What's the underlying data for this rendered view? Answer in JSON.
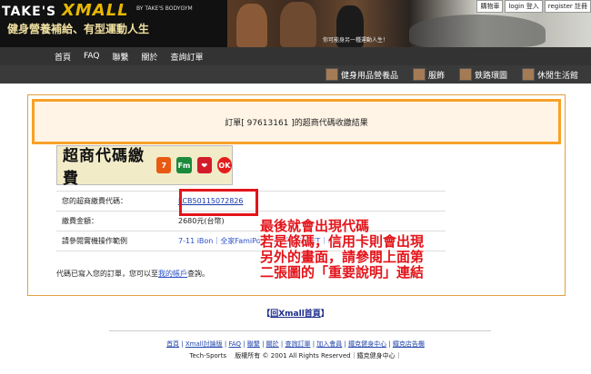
{
  "header": {
    "logo_prefix": "TAKE'S",
    "logo_main": "XMALL",
    "logo_sub": "BY TAKE'S BODYGYM",
    "slogan": "健身營養補給、有型運動人生",
    "tagline": "你可能身另一種運動人生！",
    "util": [
      "購物車",
      "login 登入",
      "register 註冊"
    ]
  },
  "nav": {
    "items": [
      "首頁",
      "FAQ",
      "聯繫",
      "關於",
      "查詢訂單"
    ]
  },
  "categories": {
    "items": [
      "健身用品營養品",
      "服飾",
      "鉄路環圖",
      "休閒生活館"
    ]
  },
  "panel": {
    "title": "訂單[ 97613161 ]的超商代碼收繳結果",
    "store_text": "超商代碼繳費",
    "chain_labels": [
      "7",
      "Fm",
      "❤",
      "OK"
    ],
    "rows": [
      {
        "label": "您的超商繳費代碼：",
        "value": "LCB50115072826"
      },
      {
        "label": "繳費金額：",
        "value": "2680元(台幣)"
      },
      {
        "label": "請參閱實機操作範例",
        "value": "7-11 iBon｜全家FamiPort｜萊爾富Life-ET｜OK"
      }
    ],
    "note_prefix": "代碼已寫入您的訂單，您可以至",
    "note_link": "我的帳戶",
    "note_suffix": "查詢。"
  },
  "annotation": {
    "lines": [
      "最後就會出現代碼",
      "若是條碼，信用卡則會出現",
      "另外的畫面，請參閱上面第",
      "二張圖的「重要說明」連結"
    ]
  },
  "back_link": {
    "open": "【",
    "label": "回Xmall首頁",
    "close": "】"
  },
  "footer": {
    "links": [
      "首頁",
      "Xmall討論版",
      "FAQ",
      "聯繫",
      "關於",
      "查詢訂單",
      "加入會員",
      "鐵克健身中心",
      "鐵克店告欄"
    ],
    "copyright": "Tech-Sports 　版權所有 © 2001 All Rights Reserved｜鐵克健身中心｜"
  },
  "colors": {
    "accent": "#f7a128",
    "highlight": "#e3141a",
    "link": "#2b50c8"
  }
}
